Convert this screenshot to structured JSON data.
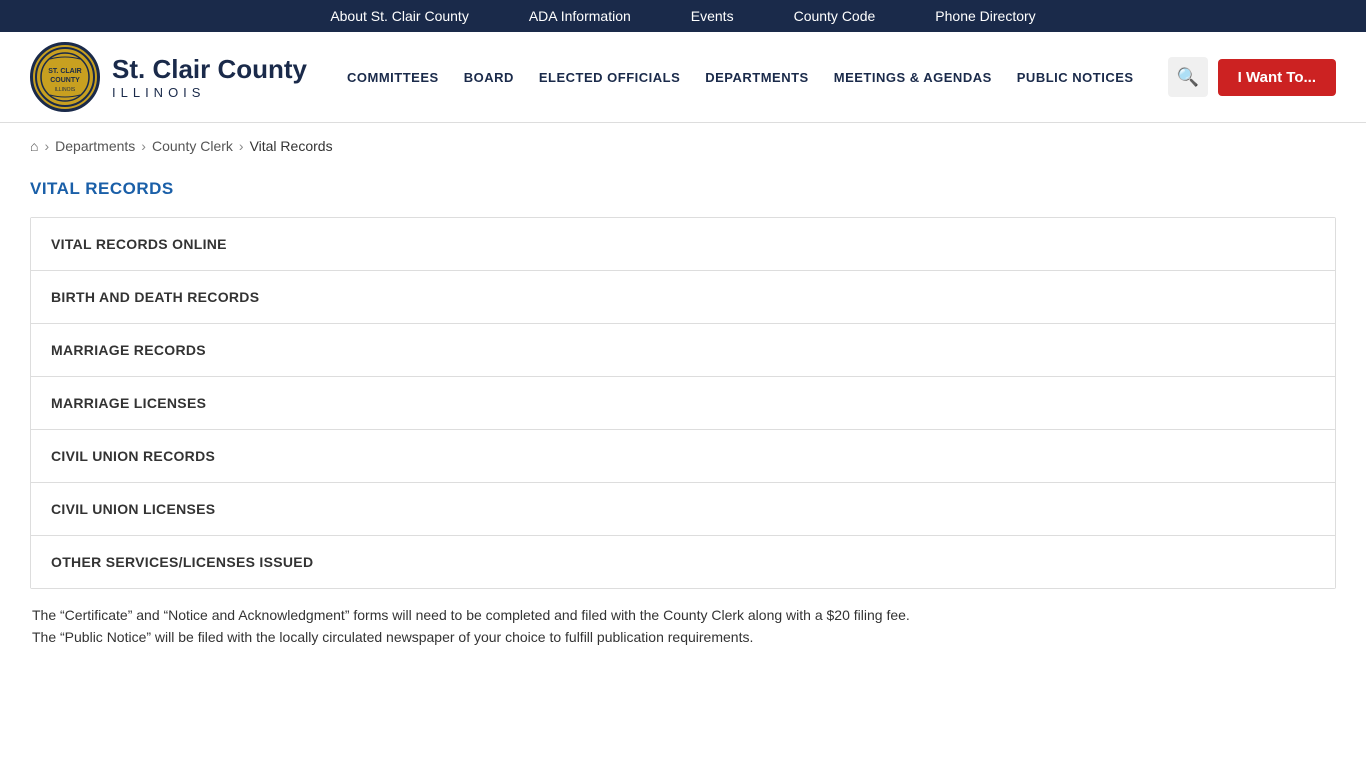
{
  "topbar": {
    "links": [
      {
        "id": "about",
        "label": "About St. Clair County"
      },
      {
        "id": "ada",
        "label": "ADA Information"
      },
      {
        "id": "events",
        "label": "Events"
      },
      {
        "id": "county-code",
        "label": "County Code"
      },
      {
        "id": "phone-directory",
        "label": "Phone Directory"
      }
    ]
  },
  "logo": {
    "county_name": "St. Clair County",
    "state": "ILLINOIS"
  },
  "nav": {
    "items": [
      {
        "id": "committees",
        "label": "COMMITTEES"
      },
      {
        "id": "board",
        "label": "BOARD"
      },
      {
        "id": "elected-officials",
        "label": "ELECTED OFFICIALS"
      },
      {
        "id": "departments",
        "label": "DEPARTMENTS"
      },
      {
        "id": "meetings-agendas",
        "label": "MEETINGS & AGENDAS"
      },
      {
        "id": "public-notices",
        "label": "PUBLIC NOTICES"
      }
    ],
    "i_want_to": "I Want To..."
  },
  "breadcrumb": {
    "home_icon": "⌂",
    "items": [
      {
        "label": "Departments",
        "href": "#"
      },
      {
        "label": "County Clerk",
        "href": "#"
      },
      {
        "label": "Vital Records",
        "current": true
      }
    ]
  },
  "page": {
    "title": "VITAL RECORDS",
    "accordion_items": [
      {
        "id": "vital-records-online",
        "label": "VITAL RECORDS ONLINE"
      },
      {
        "id": "birth-death-records",
        "label": "BIRTH AND DEATH RECORDS"
      },
      {
        "id": "marriage-records",
        "label": "MARRIAGE RECORDS"
      },
      {
        "id": "marriage-licenses",
        "label": "MARRIAGE LICENSES"
      },
      {
        "id": "civil-union-records",
        "label": "CIVIL UNION RECORDS"
      },
      {
        "id": "civil-union-licenses",
        "label": "CIVIL UNION LICENSES"
      },
      {
        "id": "other-services",
        "label": "OTHER SERVICES/LICENSES ISSUED"
      }
    ],
    "footer_text_line1": "The “Certificate” and “Notice and Acknowledgment” forms will need to be completed and filed with the County Clerk along with a $20 filing fee.",
    "footer_text_line2": "The “Public Notice” will be filed with the locally circulated newspaper of your choice to fulfill publication requirements."
  }
}
